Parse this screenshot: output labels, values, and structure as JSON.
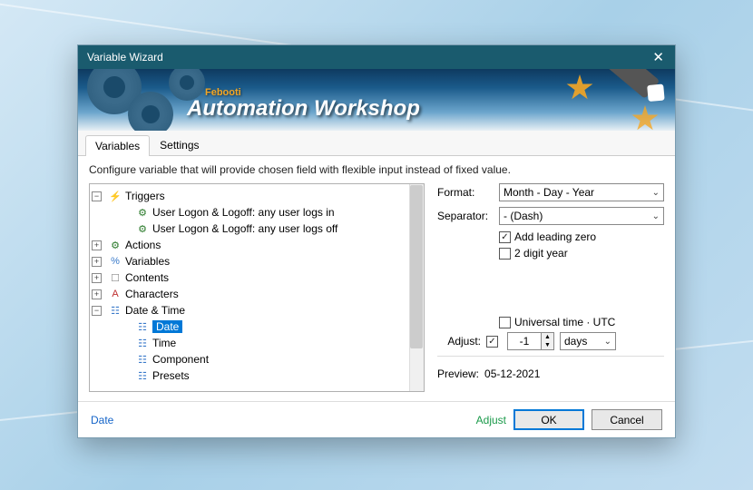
{
  "window": {
    "title": "Variable Wizard"
  },
  "banner": {
    "sub": "Febooti",
    "main": "Automation Workshop"
  },
  "tabs": {
    "variables": "Variables",
    "settings": "Settings"
  },
  "desc": "Configure variable that will provide chosen field with flexible input instead of fixed value.",
  "tree": {
    "triggers": "Triggers",
    "logon": "User Logon & Logoff: any user logs in",
    "logoff": "User Logon & Logoff: any user logs off",
    "actions": "Actions",
    "variables": "Variables",
    "contents": "Contents",
    "characters": "Characters",
    "datetime": "Date & Time",
    "date": "Date",
    "time": "Time",
    "component": "Component",
    "presets": "Presets"
  },
  "form": {
    "format_label": "Format:",
    "format_value": "Month - Day - Year",
    "separator_label": "Separator:",
    "separator_value": "- (Dash)",
    "leading_zero": "Add leading zero",
    "two_digit": "2 digit year",
    "utc": "Universal time · UTC",
    "adjust_label": "Adjust:",
    "adjust_value": "-1",
    "adjust_unit": "days",
    "preview_label": "Preview:",
    "preview_value": "05-12-2021"
  },
  "footer": {
    "left": "Date",
    "adjust": "Adjust",
    "ok": "OK",
    "cancel": "Cancel"
  }
}
